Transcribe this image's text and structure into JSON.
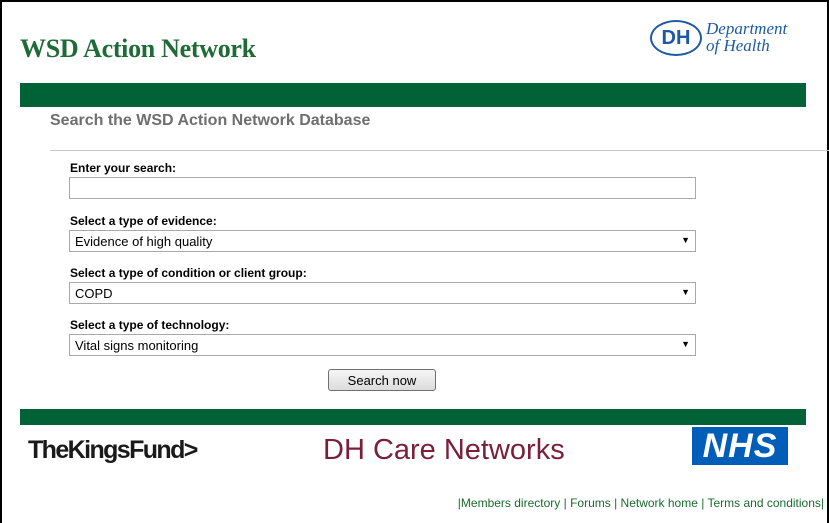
{
  "header": {
    "site_title": "WSD Action Network",
    "dh_logo": {
      "abbr": "DH",
      "line1": "Department",
      "line2": "of Health"
    }
  },
  "search_form": {
    "heading": "Search the WSD Action Network Database",
    "search_label": "Enter your search:",
    "search_value": "",
    "evidence_label": "Select a type of evidence:",
    "evidence_value": "Evidence of high quality",
    "condition_label": "Select a type of condition or client group:",
    "condition_value": "COPD",
    "technology_label": "Select a type of technology:",
    "technology_value": "Vital signs monitoring",
    "submit_label": "Search now"
  },
  "partners": {
    "kings_fund": "TheKingsFund>",
    "dh_care_networks": "DH Care Networks",
    "nhs": "NHS"
  },
  "footer": {
    "links": [
      "Members directory",
      "Forums",
      "Network home",
      "Terms and conditions"
    ]
  },
  "colors": {
    "brand_green": "#006236",
    "title_green": "#1f6b37",
    "dh_blue": "#1d5aa6",
    "nhs_blue": "#005eb8",
    "care_networks_maroon": "#7a1f3a"
  },
  "icons": {
    "select_arrow": "dropdown-arrow-icon"
  }
}
